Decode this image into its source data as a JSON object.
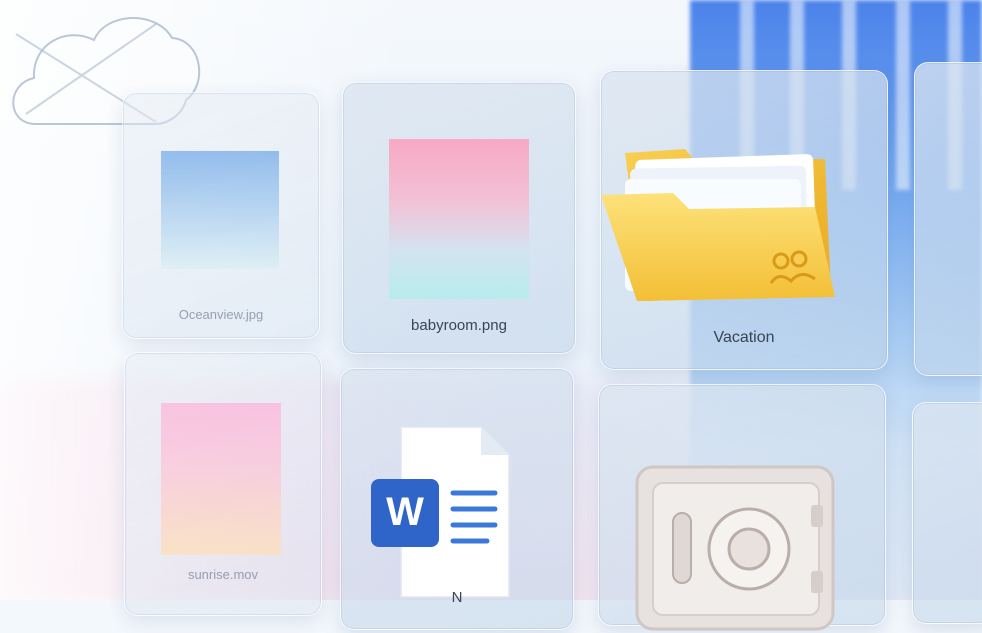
{
  "files": [
    {
      "name": "Oceanview.jpg",
      "kind": "image",
      "icon": "image-thumbnail-icon"
    },
    {
      "name": "babyroom.png",
      "kind": "image",
      "icon": "image-thumbnail-icon"
    },
    {
      "name": "Vacation",
      "kind": "folder",
      "icon": "folder-icon"
    },
    {
      "name": "sunrise.mov",
      "kind": "video",
      "icon": "video-thumbnail-icon"
    },
    {
      "name": "N",
      "kind": "word-document",
      "icon": "word-document-icon"
    },
    {
      "name": "",
      "kind": "vault",
      "icon": "vault-icon"
    }
  ],
  "word_icon": {
    "letter": "W"
  },
  "colors": {
    "folder": "#f6c945",
    "word_blue": "#2f64c8",
    "background_accent": "#2f6fe8"
  }
}
